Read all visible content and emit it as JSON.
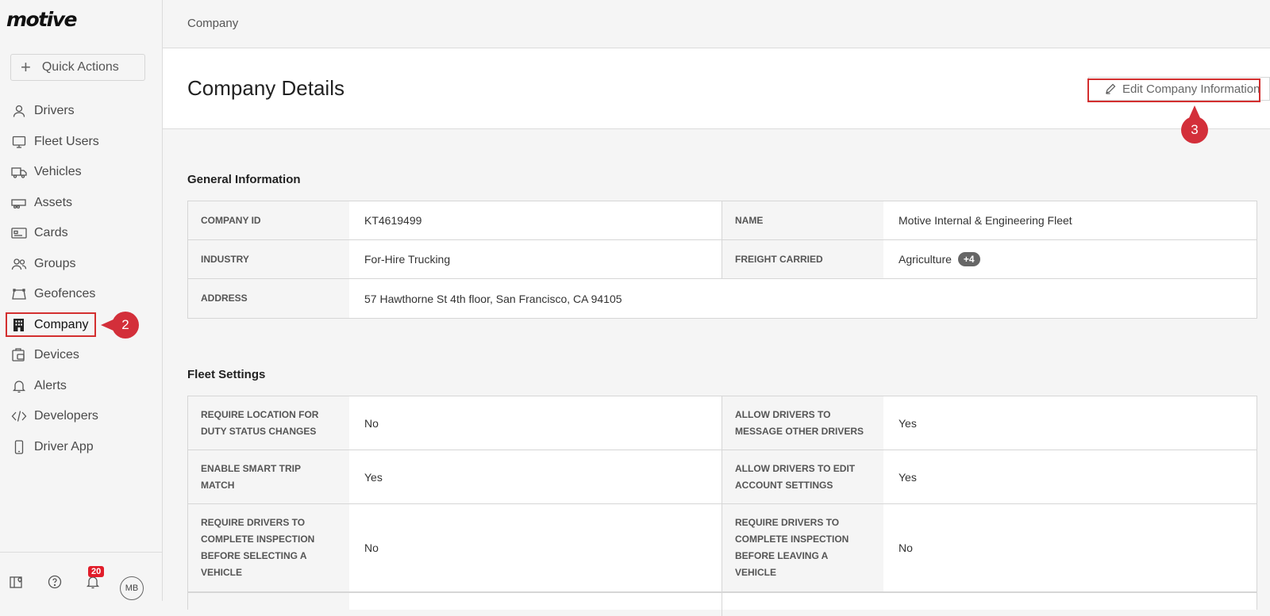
{
  "app": {
    "logo": "motive"
  },
  "sidebar": {
    "quick_actions": "Quick Actions",
    "items": [
      {
        "label": "Drivers",
        "icon": "user-icon"
      },
      {
        "label": "Fleet Users",
        "icon": "monitor-icon"
      },
      {
        "label": "Vehicles",
        "icon": "truck-icon"
      },
      {
        "label": "Assets",
        "icon": "trailer-icon"
      },
      {
        "label": "Cards",
        "icon": "card-icon"
      },
      {
        "label": "Groups",
        "icon": "group-icon"
      },
      {
        "label": "Geofences",
        "icon": "geofence-icon"
      },
      {
        "label": "Company",
        "icon": "building-icon",
        "active": true
      },
      {
        "label": "Devices",
        "icon": "devices-icon"
      },
      {
        "label": "Alerts",
        "icon": "bell-icon"
      },
      {
        "label": "Developers",
        "icon": "code-icon"
      },
      {
        "label": "Driver App",
        "icon": "phone-icon"
      }
    ],
    "footer": {
      "notifications_count": "20",
      "avatar_initials": "MB"
    }
  },
  "annotations": {
    "step2": "2",
    "step3": "3"
  },
  "topbar": {
    "breadcrumb": "Company"
  },
  "header": {
    "title": "Company Details",
    "edit_button": "Edit Company Information"
  },
  "general": {
    "title": "General Information",
    "company_id_label": "COMPANY ID",
    "company_id": "KT4619499",
    "name_label": "NAME",
    "name": "Motive Internal & Engineering Fleet",
    "industry_label": "INDUSTRY",
    "industry": "For-Hire Trucking",
    "freight_label": "FREIGHT CARRIED",
    "freight": "Agriculture",
    "freight_more": "+4",
    "address_label": "ADDRESS",
    "address": "57 Hawthorne St 4th floor, San Francisco, CA 94105"
  },
  "fleet": {
    "title": "Fleet Settings",
    "rows": [
      {
        "l1": "REQUIRE LOCATION FOR DUTY STATUS CHANGES",
        "v1": "No",
        "l2": "ALLOW DRIVERS TO MESSAGE OTHER DRIVERS",
        "v2": "Yes"
      },
      {
        "l1": "ENABLE SMART TRIP MATCH",
        "v1": "Yes",
        "l2": "ALLOW DRIVERS TO EDIT ACCOUNT SETTINGS",
        "v2": "Yes"
      },
      {
        "l1": "REQUIRE DRIVERS TO COMPLETE INSPECTION BEFORE SELECTING A VEHICLE",
        "v1": "No",
        "l2": "REQUIRE DRIVERS TO COMPLETE INSPECTION BEFORE LEAVING A VEHICLE",
        "v2": "No"
      }
    ]
  }
}
